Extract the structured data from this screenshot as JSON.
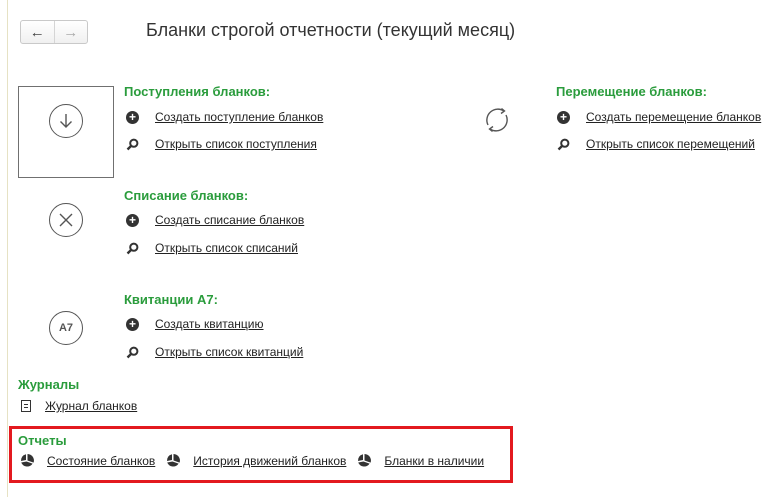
{
  "header": {
    "title": "Бланки строгой отчетности (текущий месяц)",
    "back_icon": "arrow-left-icon",
    "forward_icon": "arrow-right-icon"
  },
  "groups": {
    "receipts": {
      "title": "Поступления бланков:",
      "create": "Создать поступление бланков",
      "list": "Открыть список поступления"
    },
    "movement": {
      "title": "Перемещение бланков:",
      "create": "Создать перемещение бланков",
      "list": "Открыть список перемещений"
    },
    "writeoff": {
      "title": "Списание бланков:",
      "create": "Создать списание бланков",
      "list": "Открыть список списаний"
    },
    "receipts_a7": {
      "title": "Квитанции А7:",
      "icon_text": "А7",
      "create": "Создать квитанцию",
      "list": "Открыть список квитанций"
    }
  },
  "journals": {
    "title": "Журналы",
    "items": [
      "Журнал бланков"
    ]
  },
  "reports": {
    "title": "Отчеты",
    "items": [
      "Состояние бланков",
      "История движений бланков",
      "Бланки в наличии"
    ]
  },
  "colors": {
    "section_green": "#2a9c3c",
    "highlight_red": "#e3191f"
  }
}
